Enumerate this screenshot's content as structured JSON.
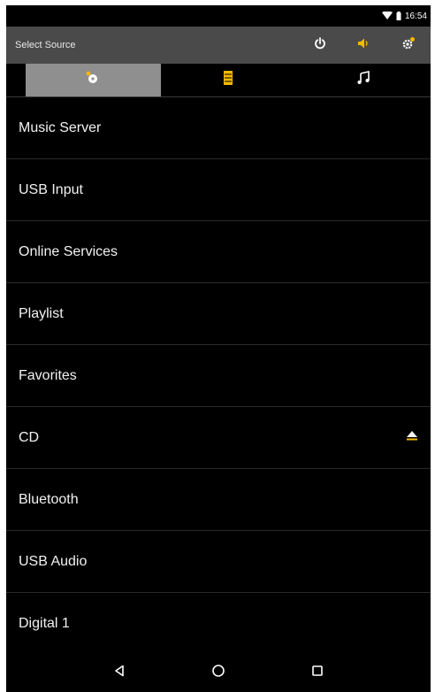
{
  "status_bar": {
    "time": "16:54",
    "icons": [
      "wifi-icon",
      "battery-icon"
    ]
  },
  "app_bar": {
    "title": "Select Source",
    "actions": [
      "power-icon",
      "volume-icon",
      "settings-icon"
    ],
    "accent_color": "#f5b800"
  },
  "tabs": [
    {
      "icon": "source-icon",
      "active": true
    },
    {
      "icon": "queue-icon",
      "active": false
    },
    {
      "icon": "music-note-icon",
      "active": false
    }
  ],
  "sources": [
    {
      "label": "Music Server"
    },
    {
      "label": "USB Input"
    },
    {
      "label": "Online Services"
    },
    {
      "label": "Playlist"
    },
    {
      "label": "Favorites"
    },
    {
      "label": "CD",
      "trailing_icon": "eject-icon"
    },
    {
      "label": "Bluetooth"
    },
    {
      "label": "USB Audio"
    },
    {
      "label": "Digital 1"
    }
  ],
  "nav_bar": [
    "back-icon",
    "home-icon",
    "recents-icon"
  ]
}
